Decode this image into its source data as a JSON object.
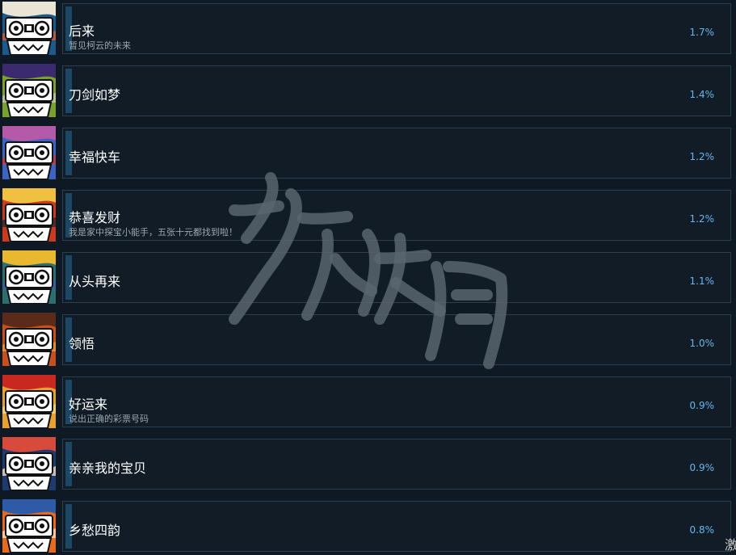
{
  "achievements": [
    {
      "title": "后来",
      "description": "暂见柯云的未来",
      "percent": "1.7%",
      "icon": "cassette-icon",
      "colors": {
        "bg": "#1d5a8c",
        "top": "#e9e4d4",
        "accent": "#d65c3a"
      }
    },
    {
      "title": "刀剑如梦",
      "description": "",
      "percent": "1.4%",
      "icon": "cassette-icon",
      "colors": {
        "bg": "#7aa12e",
        "top": "#3b2a6e",
        "accent": "#c7c4c0"
      }
    },
    {
      "title": "幸福快车",
      "description": "",
      "percent": "1.2%",
      "icon": "cassette-icon",
      "colors": {
        "bg": "#3d63c4",
        "top": "#b55aa8",
        "accent": "#c43a3a"
      }
    },
    {
      "title": "恭喜发财",
      "description": "我是家中探宝小能手，五张十元都找到啦！",
      "percent": "1.2%",
      "icon": "cassette-icon",
      "colors": {
        "bg": "#c93a1e",
        "top": "#f0c040",
        "accent": "#2a2a2a"
      }
    },
    {
      "title": "从头再来",
      "description": "",
      "percent": "1.1%",
      "icon": "cassette-icon",
      "colors": {
        "bg": "#2f6e6e",
        "top": "#e8b830",
        "accent": "#3a5ea8"
      }
    },
    {
      "title": "领悟",
      "description": "",
      "percent": "1.0%",
      "icon": "cassette-icon",
      "colors": {
        "bg": "#c8501e",
        "top": "#5a2a1a",
        "accent": "#e89a3a"
      }
    },
    {
      "title": "好运来",
      "description": "说出正确的彩票号码",
      "percent": "0.9%",
      "icon": "cassette-icon",
      "colors": {
        "bg": "#e8a030",
        "top": "#c8281e",
        "accent": "#f2d890"
      }
    },
    {
      "title": "亲亲我的宝贝",
      "description": "",
      "percent": "0.9%",
      "icon": "cassette-icon",
      "colors": {
        "bg": "#1e3a6e",
        "top": "#d84a3a",
        "accent": "#f0e0c8"
      }
    },
    {
      "title": "乡愁四韵",
      "description": "",
      "percent": "0.8%",
      "icon": "cassette-icon",
      "colors": {
        "bg": "#e86a1e",
        "top": "#2e5aa8",
        "accent": "#f2e2c2"
      }
    }
  ],
  "watermark_text": "游侠网",
  "corner_text": "激"
}
